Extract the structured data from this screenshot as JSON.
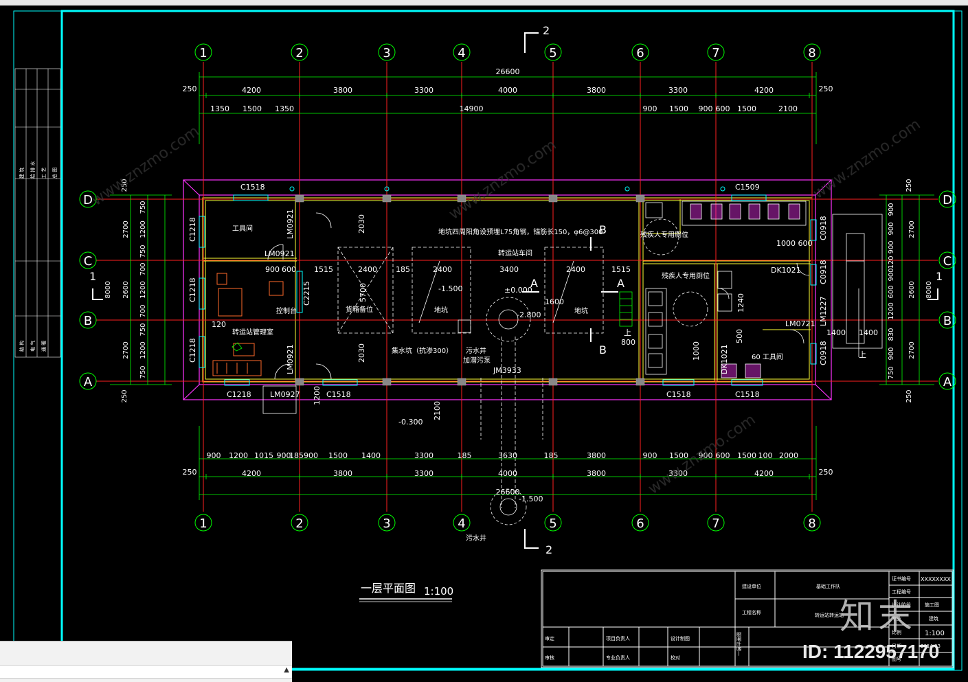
{
  "drawing": {
    "title": "一层平面图",
    "scale": "1:100",
    "colors": {
      "frame": "#00ffff",
      "grid": "#ff2020",
      "dim": "#00ff00",
      "wall": "#ffff33",
      "outline": "#ff33ff",
      "text": "#ffffff",
      "equip": "#ff6a2a"
    }
  },
  "axes": {
    "numbers": [
      "1",
      "2",
      "3",
      "4",
      "5",
      "6",
      "7",
      "8"
    ],
    "letters": [
      "D",
      "C",
      "B",
      "A"
    ]
  },
  "dims": {
    "total": "26600",
    "edge": "250",
    "bays_top": [
      "4200",
      "3800",
      "3300",
      "4000",
      "3800",
      "3300",
      "4200"
    ],
    "sub_top": [
      "1350",
      "1500",
      "1350",
      "14900",
      "900",
      "1500",
      "900",
      "600",
      "1500",
      "2100"
    ],
    "sub_bottom": [
      "900",
      "1200",
      "1015",
      "900",
      "185900",
      "1500",
      "1400",
      "3300",
      "185",
      "3630",
      "185",
      "3800",
      "900",
      "1500",
      "900",
      "600",
      "1500",
      "100",
      "2000"
    ],
    "bays_bottom": [
      "4200",
      "3800",
      "3300",
      "4000",
      "3800",
      "3300",
      "4200"
    ],
    "total_bottom": "26600",
    "left_rows": [
      "2700",
      "2600",
      "2700"
    ],
    "left_sub": [
      "750",
      "1200",
      "750",
      "700",
      "1200",
      "700",
      "750",
      "1200",
      "750"
    ],
    "left_total": "8000",
    "right_rows": [
      "2700",
      "2600",
      "2700"
    ],
    "right_sub": [
      "900",
      "900",
      "900",
      "120",
      "900",
      "600",
      "1200",
      "830",
      "900",
      "750"
    ],
    "right_total": "8000",
    "vert_side": [
      "250",
      "250",
      "250",
      "250"
    ]
  },
  "rooms": {
    "tool_room": "工具间",
    "manager_room": "转运站管理室",
    "control": "控制台",
    "transfer_hall": "转运站车间",
    "transfer_hall_note": "地坑四周阳角设预埋L75角钢，锚筋长150，φ6@300",
    "pit": "地坑",
    "pit2": "地坑",
    "storage": "货箱备位",
    "sump": "集水坑（抗渗300）",
    "sewage_well": "污水井",
    "sewage_pump": "加潜污泵",
    "disabled_wc1": "残疾人专用厕位",
    "disabled_wc2": "残疾人专用厕位",
    "tool_room2": "60 工具间"
  },
  "labels": {
    "c1518_top": "C1518",
    "c1509_top": "C1509",
    "c1218_a": "C1218",
    "c1218_b": "C1218",
    "c1218_c": "C1218",
    "c1218_bottom": "C1218",
    "lm0927": "LM0927",
    "c1518_b1": "C1518",
    "c1518_b2": "C1518",
    "c1518_b3": "C1518",
    "lm0921_a": "LM0921",
    "lm0921_b": "LM0921",
    "lm0921_c": "LM0921",
    "c2215": "C2215",
    "jm3933": "JM3933",
    "c0918_a": "C0918",
    "c0918_b": "C0918",
    "c0918_c": "C0918",
    "lm1227": "LM1227",
    "lm0721": "LM0721",
    "dk1021_a": "DK1021",
    "dk1021_b": "DK1021",
    "elev_0": "±0.000",
    "elev_m150": "-1.500",
    "elev_m030": "-0.300",
    "elev_m280": "-2.800",
    "elev_m1500": "-1.500",
    "d2400a": "2400",
    "d2400b": "2400",
    "d2400c": "2400",
    "d3400": "3400",
    "d1515a": "1515",
    "d1515b": "1515",
    "d900": "900",
    "d600": "600",
    "d185": "185",
    "d5700": "5700",
    "d2030a": "2030",
    "d2030b": "2030",
    "d120": "120",
    "d500": "500",
    "d1600": "1600",
    "d800": "800",
    "d2100": "2100",
    "d1200": "1200",
    "d1000": "1000",
    "d1240": "1240",
    "d1400a": "1400",
    "d1400b": "1400",
    "d1000_600": "1000  600",
    "up": "上",
    "section_a": "A",
    "section_b": "B",
    "section_1": "1",
    "section_2": "2"
  },
  "titleblock": {
    "build_unit_label": "建设单位",
    "build_unit": "基础工作队",
    "project_label": "工程名称",
    "project": "转运站转运站",
    "cert_label": "证书编号",
    "cert": "XXXXXXXX",
    "proj_no_label": "工程编号",
    "stage_label": "设计阶段",
    "stage": "施工图",
    "major_label": "专业",
    "major": "建筑",
    "scale_label": "比例",
    "scale": "1:100",
    "date_label": "日期",
    "date": "2014.03",
    "review": "审定",
    "audit": "审核",
    "proj_leader": "项目负责人",
    "major_leader": "专业负责人",
    "design": "设计制图",
    "check": "校对",
    "drawing_name": "一层平面图",
    "drawing_no_label": "图号"
  },
  "left_strip": {
    "col1": [
      "建",
      "筑",
      "给",
      "排",
      "水",
      "工",
      "艺",
      "总",
      "图"
    ],
    "col2": [
      "结",
      "构",
      "电",
      "气",
      "通",
      "暖"
    ]
  },
  "watermark": {
    "logo": "知末",
    "id": "ID: 1122957170",
    "site": "www.znzmo.com"
  }
}
